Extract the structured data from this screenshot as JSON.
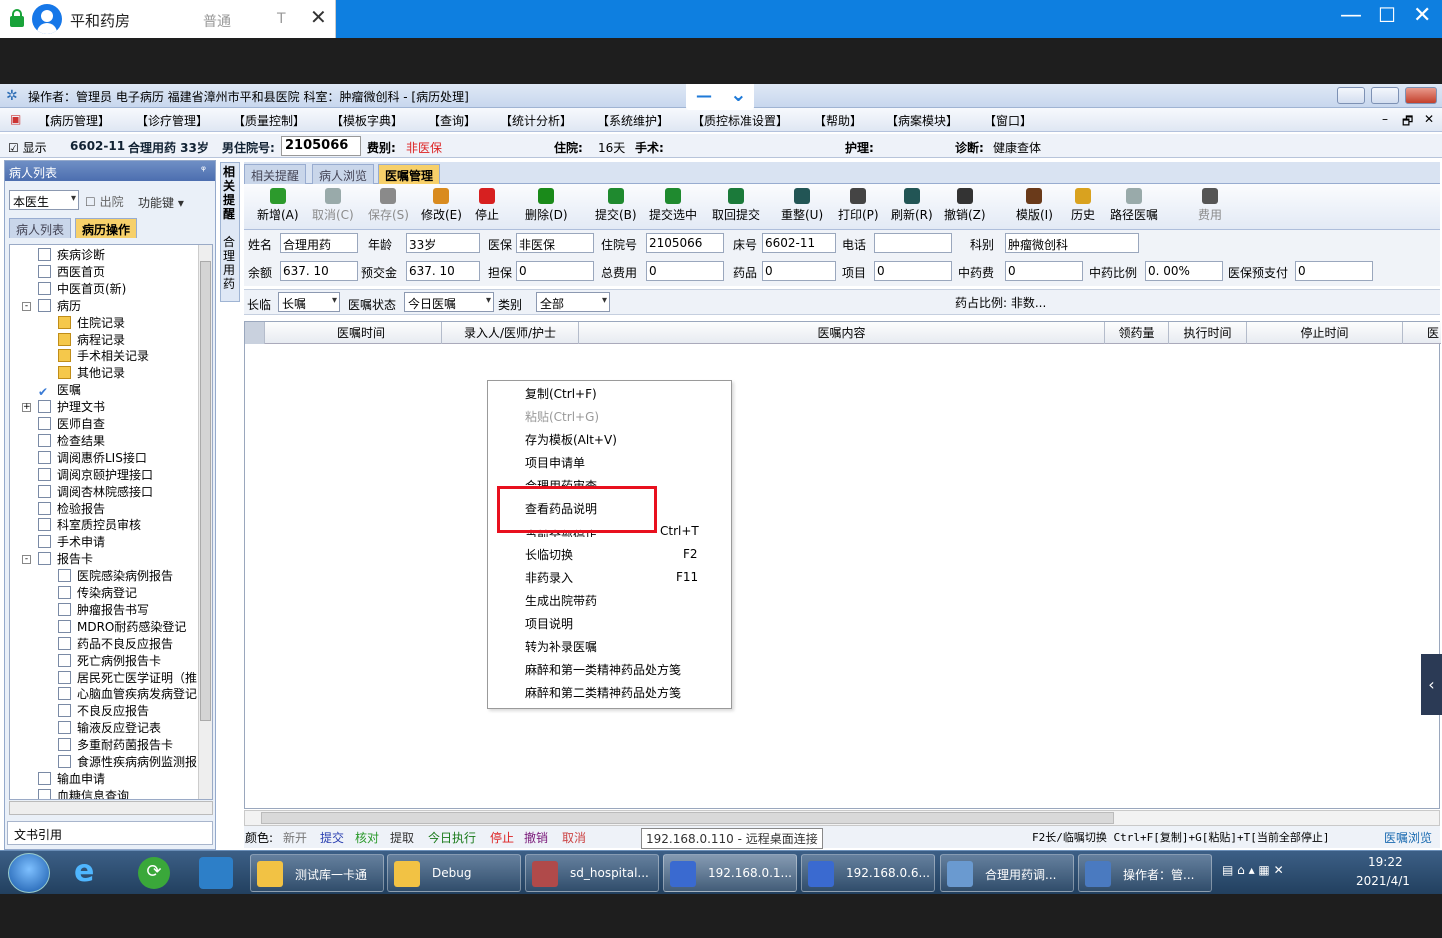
{
  "remote": {
    "tab_title": "平和药房",
    "mode_label": "普通",
    "t_label": "T",
    "close": "✕",
    "min": "—",
    "max": "☐",
    "winclose": "✕",
    "toggle_min": "—",
    "toggle_chev": "⌄"
  },
  "app": {
    "title": "操作者：管理员 电子病历  福建省漳州市平和县医院  科室：肿瘤微创科 - [病历处理]",
    "menu": [
      "【病历管理】",
      "【诊疗管理】",
      "【质量控制】",
      "【模板字典】",
      "【查询】",
      "【统计分析】",
      "【系统维护】",
      "【质控标准设置】",
      "【帮助】",
      "【病案模块】",
      "【窗口】"
    ],
    "mdi": [
      "–",
      "🗗",
      "✕"
    ],
    "patient": {
      "show": "显示",
      "bed": "6602-11",
      "name_age": "合理用药 33岁",
      "sex": "男",
      "adm_label": "住院号:",
      "adm_no": "2105066",
      "fee_label": "费别:",
      "fee": "非医保",
      "stay_label": "住院:",
      "stay": "16天",
      "op_label": "手术:",
      "nurse_label": "护理:",
      "diag_label": "诊断:",
      "diag": "健康查体"
    }
  },
  "left": {
    "header": "病人列表",
    "pin": "ᵠ",
    "doctor": "本医生",
    "discharge": "出院",
    "func": "功能键",
    "tab1": "病人列表",
    "tab2": "病历操作",
    "tree": [
      "疾病诊断",
      "西医首页",
      "中医首页(新)",
      "病历",
      "住院记录",
      "病程记录",
      "手术相关记录",
      "其他记录",
      "医嘱",
      "护理文书",
      "医师自查",
      "检查结果",
      "调阅惠侨LIS接口",
      "调阅京颐护理接口",
      "调阅杏林院感接口",
      "检验报告",
      "科室质控员审核",
      "手术申请",
      "报告卡",
      "医院感染病例报告",
      "传染病登记",
      "肿瘤报告书写",
      "MDRO耐药感染登记",
      "药品不良反应报告",
      "死亡病例报告卡",
      "居民死亡医学证明（推",
      "心脑血管疾病发病登记",
      "不良反应报告",
      "输液反应登记表",
      "多重耐药菌报告卡",
      "食源性疾病病例监测报",
      "输血申请",
      "血糖信息查询"
    ],
    "footer": "文书引用"
  },
  "right": {
    "vtab1": "相关提醒",
    "vtab2": "合理用药",
    "tabs": [
      "相关提醒",
      "病人浏览",
      "医嘱管理"
    ],
    "toolbar": [
      "新增(A)",
      "取消(C)",
      "保存(S)",
      "修改(E)",
      "停止",
      "删除(D)",
      "提交(B)",
      "提交选中",
      "取回提交",
      "重整(U)",
      "打印(P)",
      "刷新(R)",
      "撤销(Z)",
      "模版(I)",
      "历史",
      "路径医嘱",
      "费用"
    ],
    "form": {
      "name_l": "姓名",
      "name": "合理用药",
      "age_l": "年龄",
      "age": "33岁",
      "ins_l": "医保",
      "ins": "非医保",
      "adm_l": "住院号",
      "adm": "2105066",
      "bed_l": "床号",
      "bed": "6602-11",
      "tel_l": "电话",
      "tel": "",
      "dept_l": "科别",
      "dept": "肿瘤微创科",
      "bal_l": "余额",
      "bal": "637. 10",
      "pre_l": "预交金",
      "pre": "637. 10",
      "gua_l": "担保",
      "gua": "0",
      "tot_l": "总费用",
      "tot": "0",
      "drug_l": "药品",
      "drug": "0",
      "item_l": "项目",
      "item": "0",
      "cm_l": "中药费",
      "cm": "0",
      "cmr_l": "中药比例",
      "cmr": "0. 00%",
      "insp_l": "医保预支付",
      "insp": "0"
    },
    "filter": {
      "type_l": "长临",
      "type": "长嘱",
      "status_l": "医嘱状态",
      "status": "今日医嘱",
      "cat_l": "类别",
      "cat": "全部",
      "ratio": "药占比例: 非数..."
    },
    "columns": [
      "医嘱时间",
      "录入人/医师/护士",
      "医嘱内容",
      "领药量",
      "执行时间",
      "停止时间",
      "医"
    ],
    "legend": {
      "color_l": "颜色:",
      "items": [
        "新开",
        "提交",
        "核对",
        "提取",
        "今日执行",
        "停止",
        "撤销",
        "取消"
      ],
      "tooltip": "192.168.0.110 - 远程桌面连接",
      "hint": "F2长/临嘱切换 Ctrl+F[复制]+G[粘贴]+T[当前全部停止]",
      "browse": "医嘱浏览"
    }
  },
  "ctx": {
    "items": [
      "复制(Ctrl+F)",
      "粘贴(Ctrl+G)",
      "存为模板(Alt+V)",
      "项目申请单",
      "合理用药审查",
      "查看药品说明",
      "当前全部停止",
      "长临切换",
      "非药录入",
      "生成出院带药",
      "项目说明",
      "转为补录医嘱",
      "麻醉和第一类精神药品处方笺",
      "麻醉和第二类精神药品处方笺"
    ],
    "shortcuts": {
      "stop": "Ctrl+T",
      "switch": "F2",
      "nondrug": "F11"
    }
  },
  "taskbar": {
    "items": [
      "测试库一卡通",
      "Debug",
      "sd_hospital...",
      "192.168.0.1...",
      "192.168.0.6...",
      "合理用药调...",
      "操作者：管..."
    ],
    "time": "19:22",
    "date": "2021/4/1"
  },
  "colors": {
    "accent": "#0e7fe0",
    "tabActive": "#f7d06a",
    "alert": "#e8101e"
  }
}
